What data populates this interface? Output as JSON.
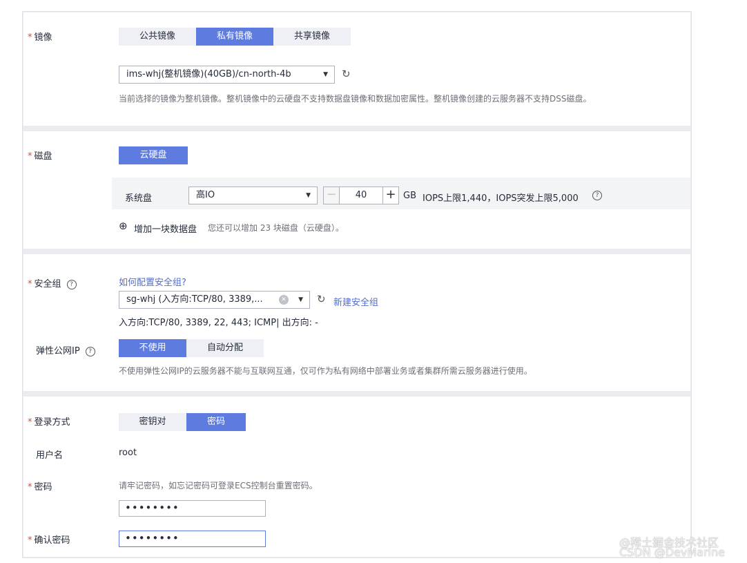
{
  "image_section": {
    "label": "镜像",
    "tabs": [
      "公共镜像",
      "私有镜像",
      "共享镜像"
    ],
    "active_tab": 1,
    "selected_image": "ims-whj(整机镜像)(40GB)/cn-north-4b",
    "hint": "当前选择的镜像为整机镜像。整机镜像中的云硬盘不支持数据盘镜像和数据加密属性。整机镜像创建的云服务器不支持DSS磁盘。"
  },
  "disk_section": {
    "label": "磁盘",
    "type_button": "云硬盘",
    "system_disk_label": "系统盘",
    "disk_type": "高IO",
    "size_value": "40",
    "size_unit": "GB",
    "iops_text": "IOPS上限1,440，IOPS突发上限5,000",
    "add_disk_label": "增加一块数据盘",
    "add_disk_hint": "您还可以增加 23 块磁盘（云硬盘）。"
  },
  "security_section": {
    "label": "安全组",
    "help_link": "如何配置安全组?",
    "selected_group": "sg-whj (入方向:TCP/80, 3389,...",
    "new_group_link": "新建安全组",
    "rules_summary": "入方向:TCP/80, 3389, 22, 443; ICMP| 出方向: -",
    "eip_label": "弹性公网IP",
    "eip_options": [
      "不使用",
      "自动分配"
    ],
    "eip_active": 0,
    "eip_hint": "不使用弹性公网IP的云服务器不能与互联网互通，仅可作为私有网络中部署业务或者集群所需云服务器进行使用。"
  },
  "login_section": {
    "label": "登录方式",
    "options": [
      "密钥对",
      "密码"
    ],
    "active": 1,
    "username_label": "用户名",
    "username_value": "root",
    "password_label": "密码",
    "password_hint": "请牢记密码，如忘记密码可登录ECS控制台重置密码。",
    "password_value": "••••••••",
    "confirm_label": "确认密码",
    "confirm_value": "••••••••"
  },
  "watermark": {
    "line1": "@稀土掘金技术社区",
    "line2": "CSDN @DevMarine"
  },
  "icons": {
    "required": "*",
    "refresh": "↻",
    "caret": "▼",
    "help": "?",
    "clear": "✕",
    "add": "⊕",
    "minus": "−",
    "plus": "+"
  },
  "colors": {
    "accent": "#5e7ce0",
    "link": "#526ecc",
    "required": "#e5473b"
  }
}
